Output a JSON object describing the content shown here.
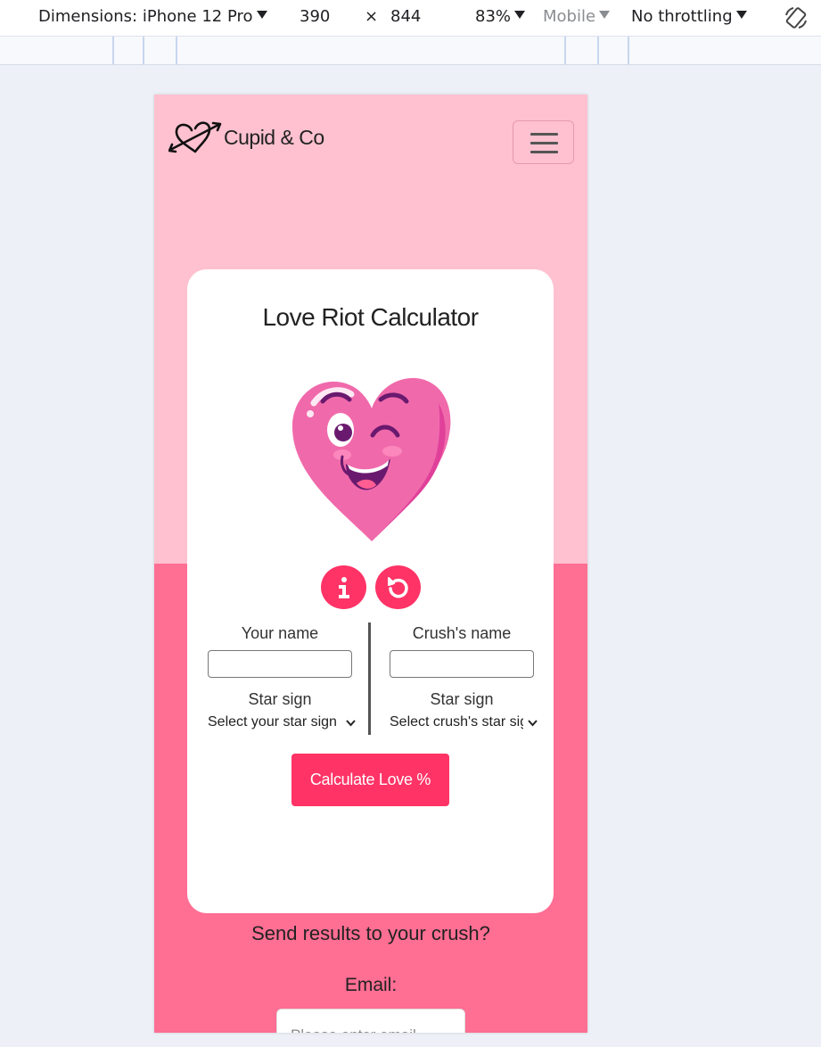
{
  "devtools": {
    "dimensions_label": "Dimensions: iPhone 12 Pro",
    "width": "390",
    "times": "×",
    "height": "844",
    "zoom": "83%",
    "mode": "Mobile",
    "throttling": "No throttling"
  },
  "nav": {
    "brand": "Cupid & Co"
  },
  "card": {
    "title": "Love Riot Calculator",
    "your_name_label": "Your name",
    "crush_name_label": "Crush's name",
    "star_sign_label_left": "Star sign",
    "star_sign_label_right": "Star sign",
    "your_star_select": "Select your star sign",
    "crush_star_select": "Select crush's star sign",
    "calculate_label": "Calculate Love %"
  },
  "send": {
    "title": "Send results to your crush?",
    "email_label": "Email:",
    "email_placeholder": "Please enter email"
  },
  "colors": {
    "page_top": "#ffc1d0",
    "page_bottom": "#ff6e93",
    "accent": "#ff3366"
  }
}
